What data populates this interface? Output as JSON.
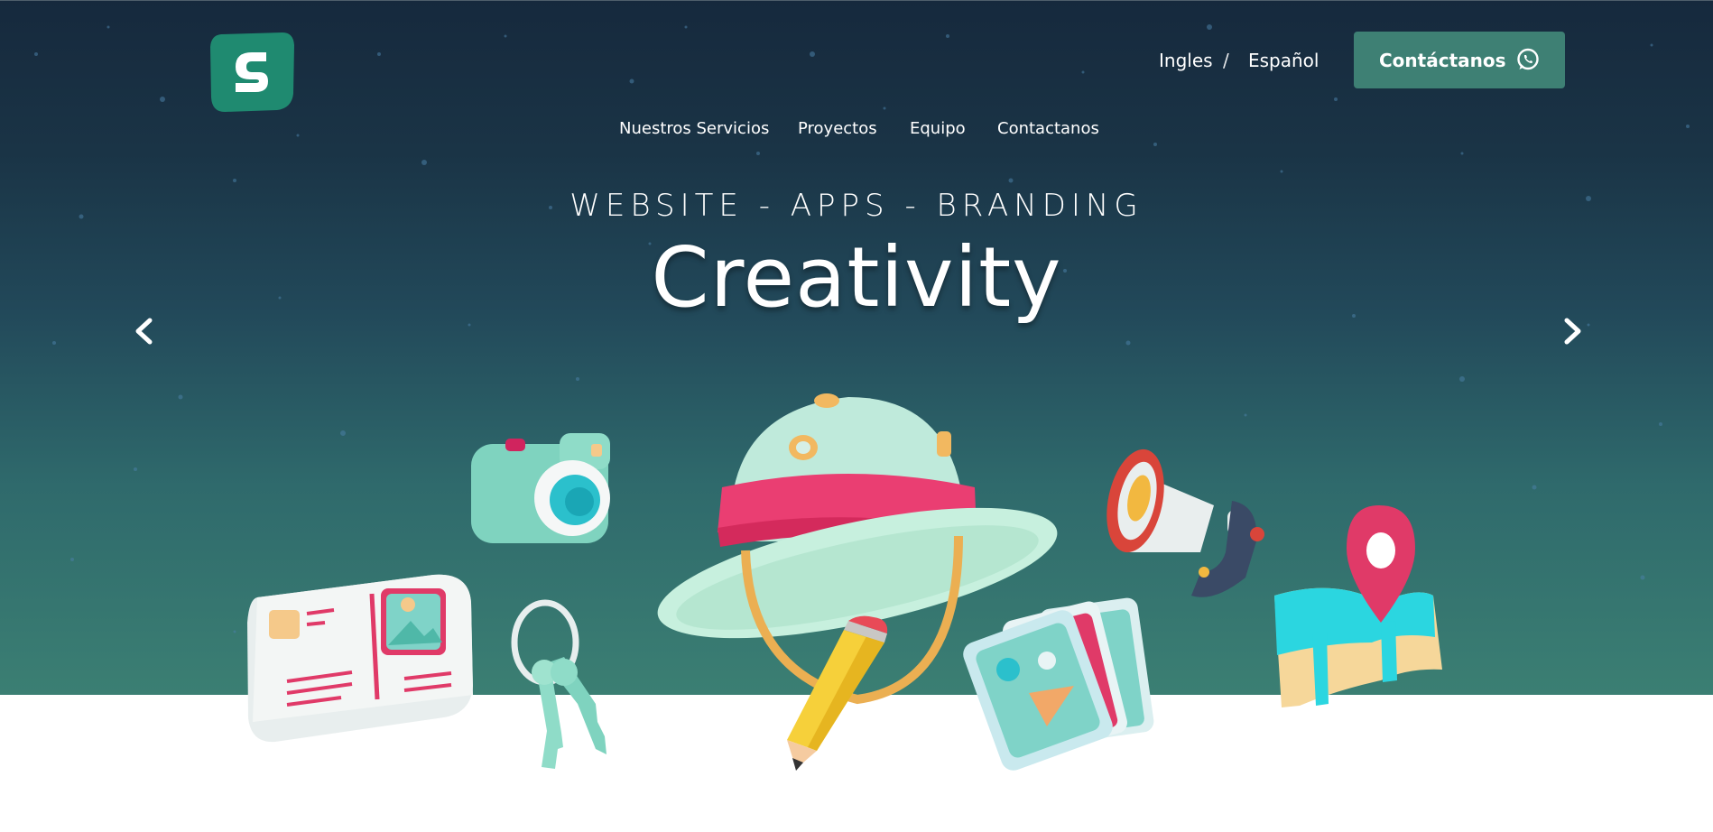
{
  "header": {
    "logo": "brand-logo",
    "lang_en": "Ingles",
    "lang_sep": "/",
    "lang_es": "Español",
    "cta_label": "Contáctanos",
    "cta_icon": "whatsapp-icon"
  },
  "nav": {
    "items": [
      "Nuestros Servicios",
      "Proyectos",
      "Equipo",
      "Contactanos"
    ]
  },
  "hero": {
    "tagline": "WEBSITE - APPS - BRANDING",
    "headline": "Creativity",
    "prev_icon": "chevron-left-icon",
    "next_icon": "chevron-right-icon"
  },
  "colors": {
    "hero_top": "#16293d",
    "hero_bottom": "#3b7f73",
    "accent": "#3e8074",
    "logo": "#1f8a70"
  }
}
